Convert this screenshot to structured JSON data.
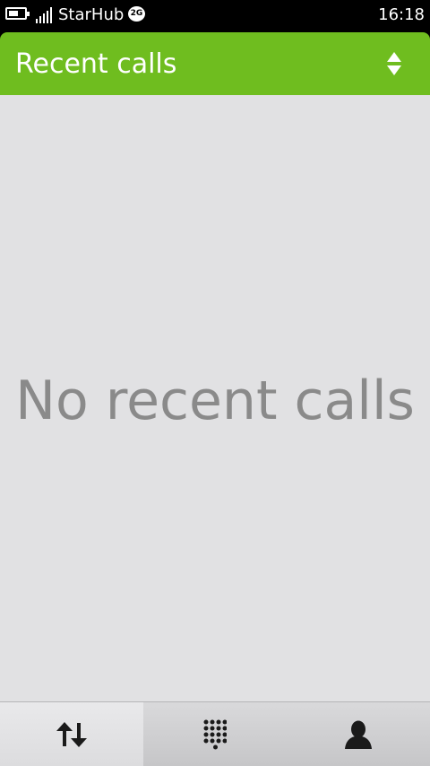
{
  "status_bar": {
    "operator": "StarHub",
    "network_type": "2G",
    "time": "16:18",
    "battery_icon": "battery-icon",
    "signal_icon": "signal-strength-icon"
  },
  "header": {
    "title": "Recent calls",
    "sort_icon": "sort-updown-icon"
  },
  "content": {
    "empty_message": "No recent calls"
  },
  "toolbar": {
    "tabs": [
      {
        "icon": "call-history-icon",
        "active": true
      },
      {
        "icon": "dialpad-icon",
        "active": false
      },
      {
        "icon": "contacts-icon",
        "active": false
      }
    ]
  },
  "colors": {
    "accent": "#6fbd1f",
    "background": "#e1e1e3",
    "empty_text": "#8a8a8a"
  }
}
